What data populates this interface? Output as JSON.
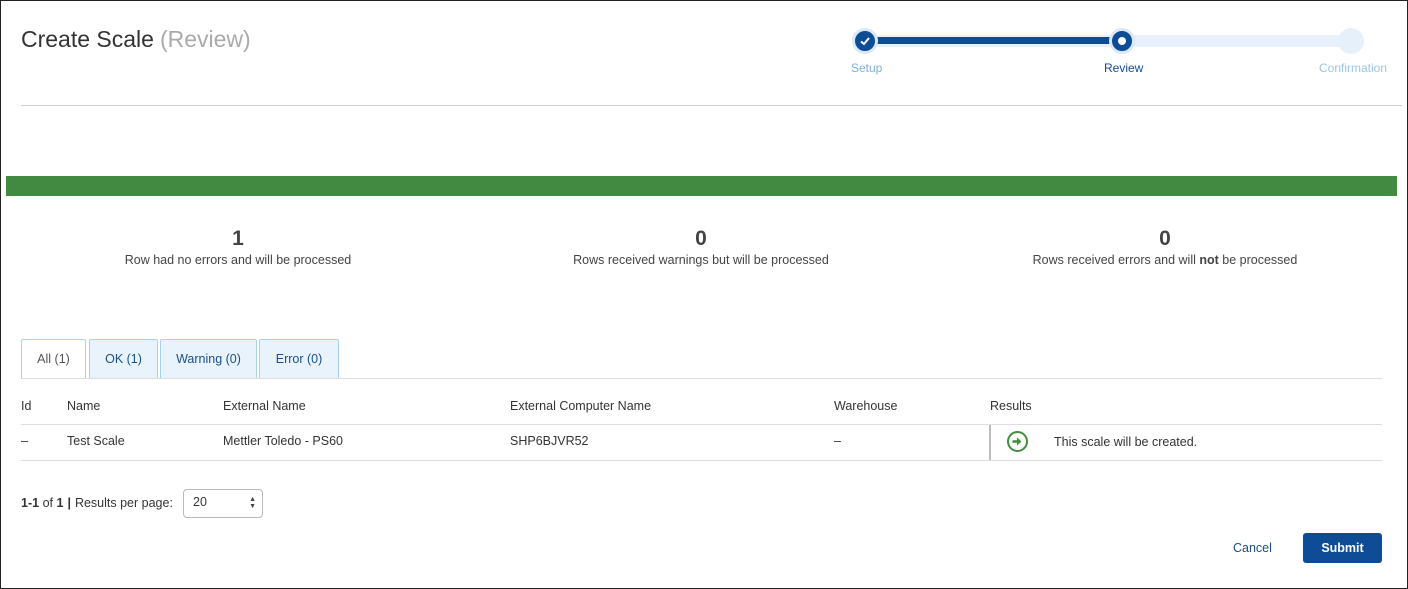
{
  "header": {
    "title": "Create Scale",
    "subtitle": "(Review)"
  },
  "stepper": {
    "steps": [
      {
        "label": "Setup",
        "state": "done"
      },
      {
        "label": "Review",
        "state": "current"
      },
      {
        "label": "Confirmation",
        "state": "upcoming"
      }
    ],
    "done_icon": "check-icon"
  },
  "status_bar": {
    "color": "#428a42"
  },
  "summary": {
    "ok": {
      "count": "1",
      "text": "Row had no errors and will be processed"
    },
    "warnings": {
      "count": "0",
      "text": "Rows received warnings but will be processed"
    },
    "errors": {
      "count": "0",
      "text_before": "Rows received errors and will ",
      "text_bold": "not",
      "text_after": " be processed"
    }
  },
  "tabs": [
    {
      "label": "All (1)",
      "active": true
    },
    {
      "label": "OK (1)",
      "active": false
    },
    {
      "label": "Warning (0)",
      "active": false
    },
    {
      "label": "Error (0)",
      "active": false
    }
  ],
  "table": {
    "columns": [
      "Id",
      "Name",
      "External Name",
      "External Computer Name",
      "Warehouse",
      "Results"
    ],
    "rows": [
      {
        "id": "–",
        "name": "Test Scale",
        "external_name": "Mettler Toledo - PS60",
        "external_computer_name": "SHP6BJVR52",
        "warehouse": "–",
        "result_icon": "arrow-right-circle-icon",
        "result_text": "This scale will be created."
      }
    ]
  },
  "pagination": {
    "range": "1-1",
    "of_label": "of",
    "total": "1",
    "separator": "|",
    "per_page_label": "Results per page:",
    "per_page_value": "20"
  },
  "actions": {
    "cancel": "Cancel",
    "submit": "Submit"
  },
  "colors": {
    "primary": "#0e4c96",
    "success": "#428a42",
    "tab_bg": "#e8f3fc"
  }
}
